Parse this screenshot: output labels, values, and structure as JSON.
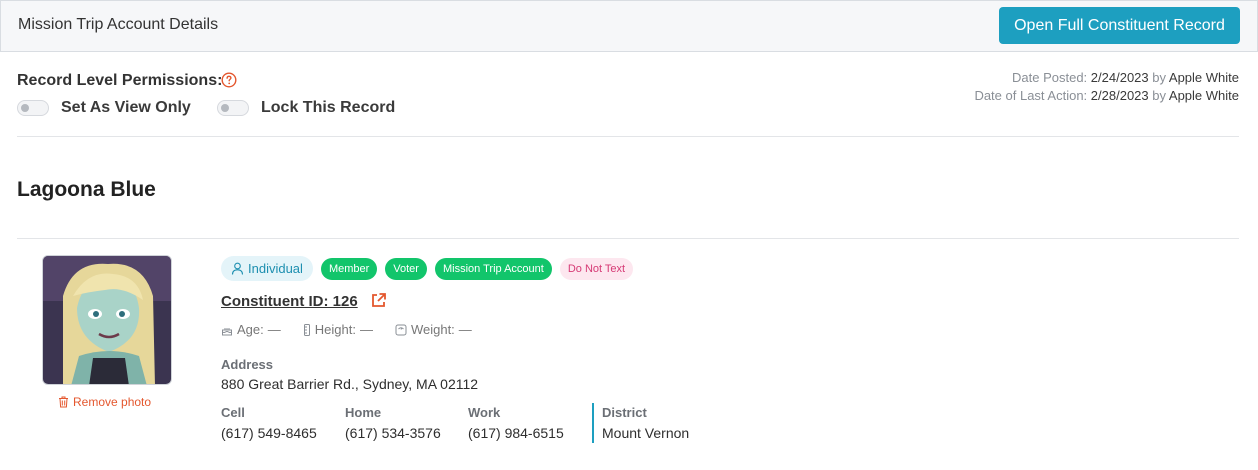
{
  "header": {
    "title": "Mission Trip Account Details",
    "open_record_label": "Open Full Constituent Record"
  },
  "permissions": {
    "label": "Record Level Permissions:",
    "view_only_label": "Set As View Only",
    "view_only_on": false,
    "lock_label": "Lock This Record",
    "lock_on": false
  },
  "meta": {
    "posted_label": "Date Posted:",
    "posted_date": "2/24/2023",
    "posted_by_label": "by",
    "posted_by": "Apple White",
    "last_action_label": "Date of Last Action:",
    "last_action_date": "2/28/2023",
    "last_action_by_label": "by",
    "last_action_by": "Apple White"
  },
  "constituent": {
    "name": "Lagoona Blue",
    "remove_photo_label": "Remove photo",
    "type_badge": "Individual",
    "tags": [
      "Member",
      "Voter",
      "Mission Trip Account"
    ],
    "warning_tag": "Do Not Text",
    "id_text": "Constituent ID: 126",
    "age_label": "Age:",
    "age": "—",
    "height_label": "Height:",
    "height": "—",
    "weight_label": "Weight:",
    "weight": "—",
    "address_label": "Address",
    "address": "880 Great Barrier Rd., Sydney, MA 02112",
    "cell_label": "Cell",
    "cell": "(617) 549-8465",
    "home_label": "Home",
    "home": "(617) 534-3576",
    "work_label": "Work",
    "work": "(617) 984-6515",
    "district_label": "District",
    "district": "Mount Vernon"
  },
  "colors": {
    "accent": "#1d9fc0",
    "tag_green": "#12c56b",
    "warning_pink": "#d63a75",
    "danger": "#e4572e"
  }
}
